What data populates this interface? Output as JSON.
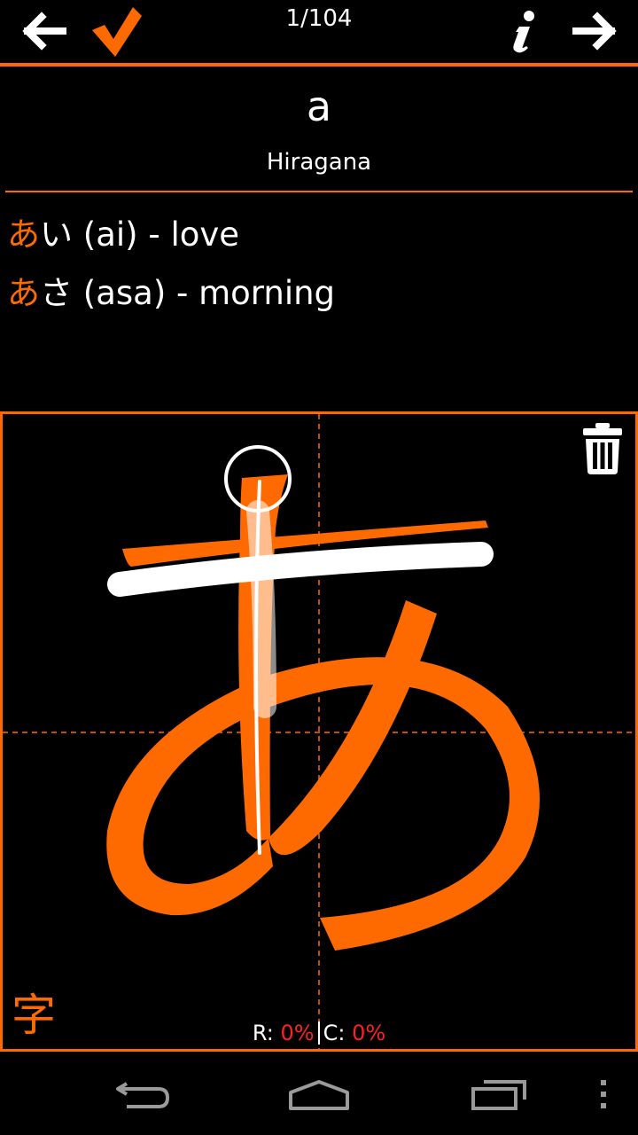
{
  "header": {
    "counter": "1/104",
    "back_icon": "arrow-left-icon",
    "check_icon": "check-icon",
    "info_icon": "info-icon",
    "next_icon": "arrow-right-icon"
  },
  "character": {
    "romaji": "a",
    "script": "Hiragana",
    "glyph": "あ"
  },
  "examples": [
    {
      "highlight": "あ",
      "rest": "い (ai) - love"
    },
    {
      "highlight": "あ",
      "rest": "さ (asa) - morning"
    }
  ],
  "canvas": {
    "trash_icon": "trash-icon",
    "kanji_button": "字",
    "stats": {
      "r_label": "R:",
      "r_value": "0%",
      "c_label": "C:",
      "c_value": "0%"
    }
  },
  "navbar": {
    "back_icon": "nav-back-icon",
    "home_icon": "nav-home-icon",
    "recents_icon": "nav-recents-icon",
    "menu_icon": "overflow-menu-icon"
  },
  "colors": {
    "accent": "#ff6a00",
    "stat_value": "#ff2020",
    "background": "#000000"
  }
}
